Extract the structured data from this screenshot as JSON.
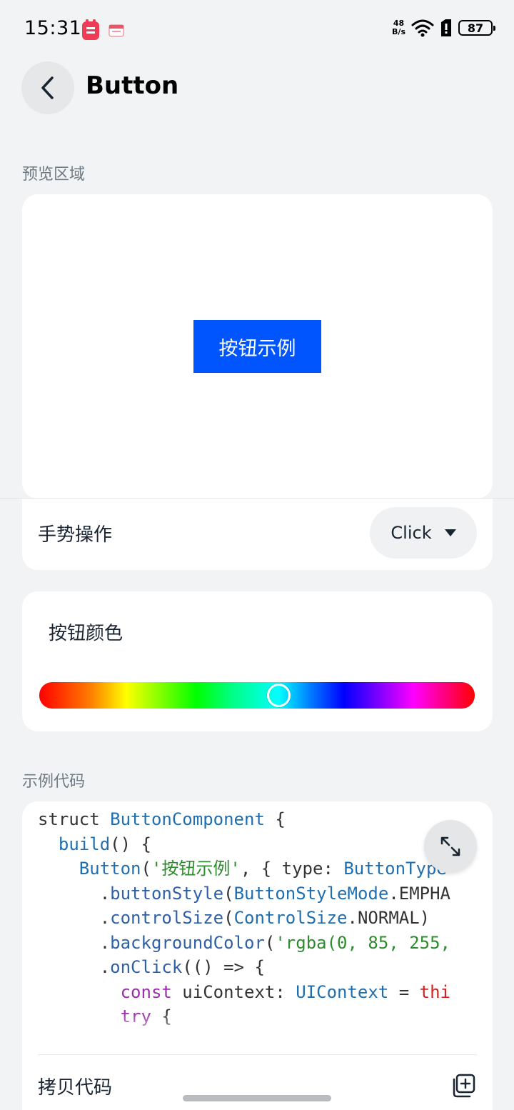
{
  "status_bar": {
    "time": "15:31",
    "net_speed_value": "48",
    "net_speed_unit": "B/s",
    "battery": "87"
  },
  "header": {
    "title": "Button"
  },
  "preview": {
    "section_label": "预览区域",
    "demo_button_label": "按钮示例"
  },
  "gesture": {
    "label": "手势操作",
    "selected": "Click"
  },
  "color": {
    "label": "按钮颜色",
    "hue_position": 0.55
  },
  "code": {
    "section_label": "示例代码",
    "lines": [
      [
        "struct ButtonComponent {"
      ],
      [
        "  build() {"
      ],
      [
        "    Button('按钮示例', { type: ButtonType"
      ],
      [
        "      .buttonStyle(ButtonStyleMode.EMPHA"
      ],
      [
        "      .controlSize(ControlSize.NORMAL)"
      ],
      [
        "      .backgroundColor('rgba(0, 85, 255,"
      ],
      [
        "      .onClick(() => {"
      ],
      [
        "        const uiContext: UIContext = thi"
      ],
      [
        "        try {"
      ]
    ],
    "copy_label": "拷贝代码"
  },
  "colors": {
    "accent": "#0055ff",
    "background": "#f1f3f5",
    "card": "#ffffff"
  },
  "icons": {
    "back": "chevron-left-icon",
    "expand": "expand-arrows-icon",
    "copy": "copy-icon",
    "wifi": "wifi-icon",
    "sim": "sim-card-icon"
  }
}
